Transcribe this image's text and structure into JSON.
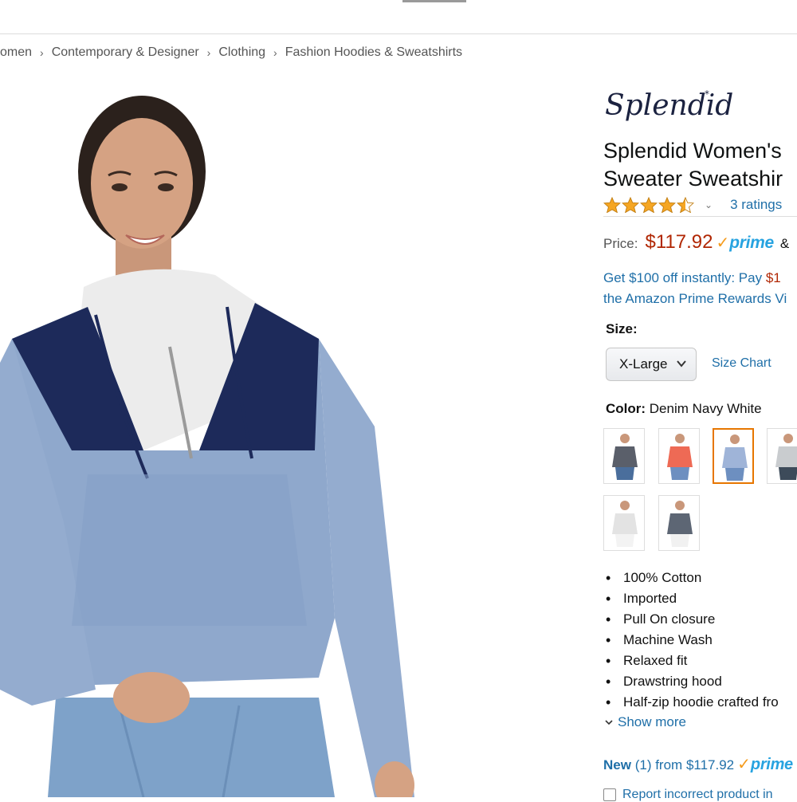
{
  "breadcrumb": {
    "items": [
      "omen",
      "Contemporary & Designer",
      "Clothing",
      "Fashion Hoodies & Sweatshirts"
    ],
    "separator": "›"
  },
  "product": {
    "brand_logo_text": "Splendid",
    "title_line1": "Splendid Women's",
    "title_line2": "Sweater Sweatshir",
    "rating": {
      "stars": 4.5,
      "max": 5,
      "ratings_label": "3 ratings"
    },
    "price_label": "Price:",
    "price": "$117.92",
    "prime_check": "✓",
    "prime_word": "prime",
    "amp": "&",
    "promo_line1_prefix": "Get $100 off instantly: Pay ",
    "promo_line1_red": "$1",
    "promo_line2": "the Amazon Prime Rewards Vi",
    "size": {
      "label": "Size:",
      "selected": "X-Large",
      "chart_link": "Size Chart"
    },
    "color": {
      "label": "Color:",
      "value": "Denim Navy White"
    },
    "swatches": [
      {
        "name": "swatch-1",
        "top": "#5a5f6a",
        "bottom": "#4a6e9c",
        "selected": false
      },
      {
        "name": "swatch-2",
        "top": "#ee6a55",
        "bottom": "#6d8fc0",
        "selected": false
      },
      {
        "name": "swatch-3",
        "top": "#9fb4d8",
        "bottom": "#6d8fc0",
        "selected": true
      },
      {
        "name": "swatch-4",
        "top": "#c9cccf",
        "bottom": "#3d4b5a",
        "selected": false
      },
      {
        "name": "swatch-5",
        "top": "#e3e3e3",
        "bottom": "#f3f3f3",
        "selected": false
      },
      {
        "name": "swatch-6",
        "top": "#5d6674",
        "bottom": "#f1f1f1",
        "selected": false
      }
    ],
    "bullets": [
      "100% Cotton",
      "Imported",
      "Pull On closure",
      "Machine Wash",
      "Relaxed fit",
      "Drawstring hood",
      "Half-zip hoodie crafted fro"
    ],
    "show_more": "Show more",
    "new_offer": {
      "new_word": "New",
      "count": "(1) from",
      "price": "$117.92"
    },
    "report_text": "Report incorrect product in"
  },
  "colors": {
    "link": "#1f6fa8",
    "price": "#b12704",
    "prime_blue": "#27a3e0",
    "prime_check": "#f59b1c",
    "star": "#f5a623",
    "selected_border": "#e77600"
  },
  "icons": [
    "star-icon",
    "chevron-down-icon",
    "dropdown-arrow-icon",
    "checkbox-icon"
  ]
}
